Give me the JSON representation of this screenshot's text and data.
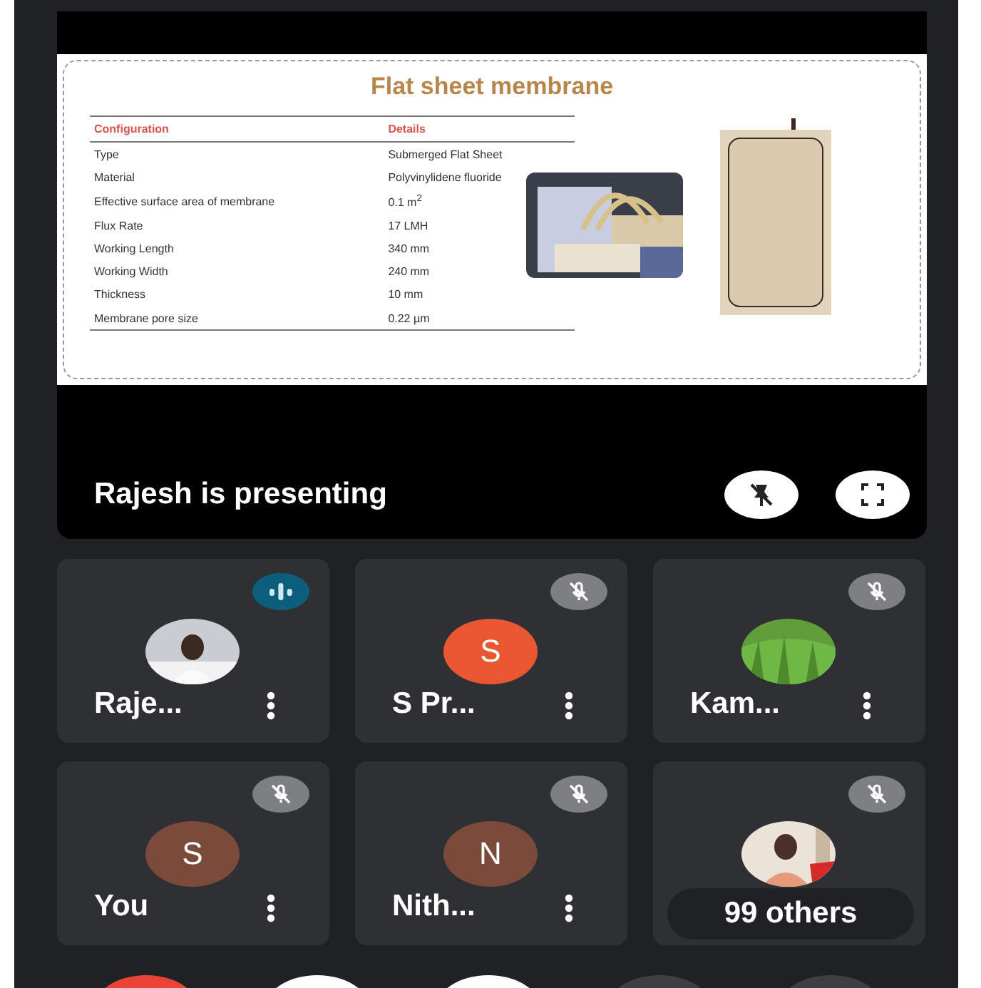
{
  "slide": {
    "title": "Flat sheet membrane",
    "columns": [
      "Configuration",
      "Details"
    ],
    "rows": [
      [
        "Type",
        "Submerged Flat Sheet"
      ],
      [
        "Material",
        "Polyvinylidene fluoride"
      ],
      [
        "Effective surface area of membrane",
        "0.1 m$^{2}$"
      ],
      [
        "Flux Rate",
        "17 LMH"
      ],
      [
        "Working Length",
        "340 mm"
      ],
      [
        "Working Width",
        "240 mm"
      ],
      [
        "Thickness",
        "10 mm"
      ],
      [
        "Membrane pore size",
        "0.22 µm"
      ]
    ]
  },
  "presenter_bar": {
    "label": "Rajesh is presenting"
  },
  "participants": [
    {
      "kind": "member",
      "name": "Raje...",
      "muted": false
    },
    {
      "kind": "member",
      "name": "S Pr...",
      "avatar": {
        "kind": "letter",
        "letter": "S",
        "color": "#e8572f"
      },
      "muted": true
    },
    {
      "kind": "member",
      "name": "Kam...",
      "muted": true
    },
    {
      "kind": "member",
      "name": "You",
      "avatar": {
        "kind": "letter",
        "letter": "S",
        "color": "#7a4a3a"
      },
      "muted": true
    },
    {
      "kind": "member",
      "name": "Nith...",
      "avatar": {
        "kind": "letter",
        "letter": "N",
        "color": "#7a4a3a"
      },
      "muted": true
    },
    {
      "kind": "others",
      "name": "99 others",
      "muted": true
    }
  ],
  "controls": [
    {
      "color": "#ea4335"
    },
    {
      "color": "#ffffff"
    },
    {
      "color": "#ffffff"
    },
    {
      "color": "#3c4043"
    },
    {
      "color": "#3c4043"
    }
  ]
}
